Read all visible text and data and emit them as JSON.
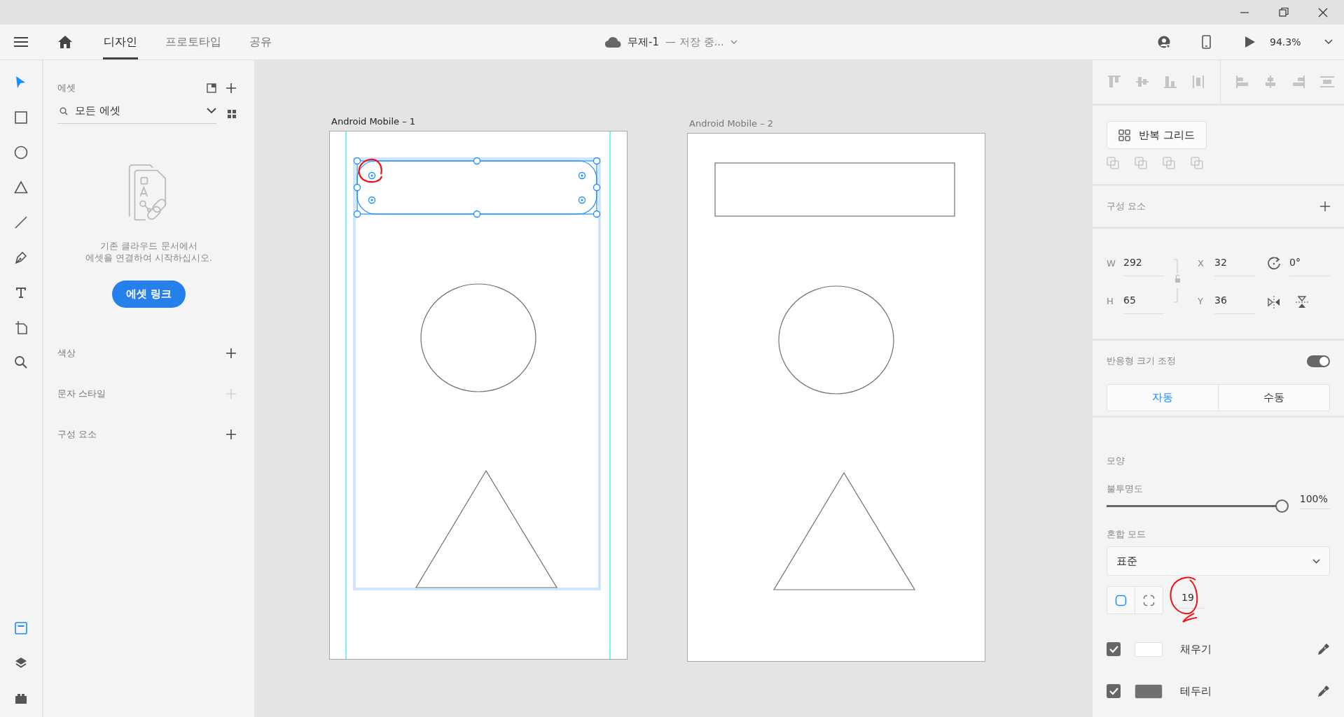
{
  "tabs": [
    {
      "label": "디자인",
      "selected": true
    },
    {
      "label": "프로토타입",
      "selected": false
    },
    {
      "label": "공유",
      "selected": false
    }
  ],
  "document": {
    "name": "무제-1",
    "status": "— 저장 중..."
  },
  "zoom": "94.3%",
  "tools": [
    {
      "kind": "select",
      "selected": true
    },
    {
      "kind": "rectangle",
      "selected": false
    },
    {
      "kind": "ellipse",
      "selected": false
    },
    {
      "kind": "triangle",
      "selected": false
    },
    {
      "kind": "line",
      "selected": false
    },
    {
      "kind": "pen",
      "selected": false
    },
    {
      "kind": "text",
      "selected": false
    },
    {
      "kind": "artboard",
      "selected": false
    },
    {
      "kind": "zoom",
      "selected": false
    }
  ],
  "panel_tabs": [
    {
      "kind": "assets",
      "selected": true
    },
    {
      "kind": "layers",
      "selected": false
    },
    {
      "kind": "plugins",
      "selected": false
    }
  ],
  "assets": {
    "title": "에셋",
    "search": {
      "value": "모든 에셋"
    },
    "empty_message": "기존 클라우드 문서에서\n에셋을 연결하여 시작하십시오.",
    "link_button": "에셋 링크",
    "sections": [
      {
        "label": "색상",
        "disabled": false
      },
      {
        "label": "문자 스타일",
        "disabled": true
      },
      {
        "label": "구성 요소",
        "disabled": false
      }
    ]
  },
  "artboards": [
    {
      "title": "Android Mobile – 1",
      "selected": true,
      "shapes": [
        {
          "kind": "rectangle",
          "rounded": true,
          "selected": true
        },
        {
          "kind": "ellipse",
          "selected": false
        },
        {
          "kind": "triangle",
          "selected": false
        }
      ]
    },
    {
      "title": "Android Mobile – 2",
      "selected": false,
      "shapes": [
        {
          "kind": "rectangle",
          "rounded": false,
          "selected": false
        },
        {
          "kind": "ellipse",
          "selected": false
        },
        {
          "kind": "triangle",
          "selected": false
        }
      ]
    }
  ],
  "properties": {
    "repeat_grid_button": "반복 그리드",
    "components_label": "구성 요소",
    "transform": [
      {
        "label": "W",
        "value": "292"
      },
      {
        "label": "X",
        "value": "32"
      },
      {
        "label": "H",
        "value": "65"
      },
      {
        "label": "Y",
        "value": "36"
      }
    ],
    "rotation": "0°",
    "responsive": {
      "label": "반응형 크기 조정",
      "on": true,
      "options": [
        {
          "label": "자동",
          "selected": true
        },
        {
          "label": "수동",
          "selected": false
        }
      ]
    },
    "appearance": {
      "title": "모양",
      "opacity": {
        "label": "불투명도",
        "level": 1,
        "reading": "100%"
      },
      "blend": {
        "label": "혼합 모드",
        "value": "표준"
      },
      "corner_modes": [
        {
          "kind": "uniform",
          "selected": true
        },
        {
          "kind": "per-corner",
          "selected": false
        }
      ],
      "radius": "19",
      "paints": [
        {
          "label": "채우기",
          "checked": true,
          "color": "#ffffff"
        },
        {
          "label": "테두리",
          "checked": true,
          "color": "#707070"
        }
      ]
    }
  }
}
